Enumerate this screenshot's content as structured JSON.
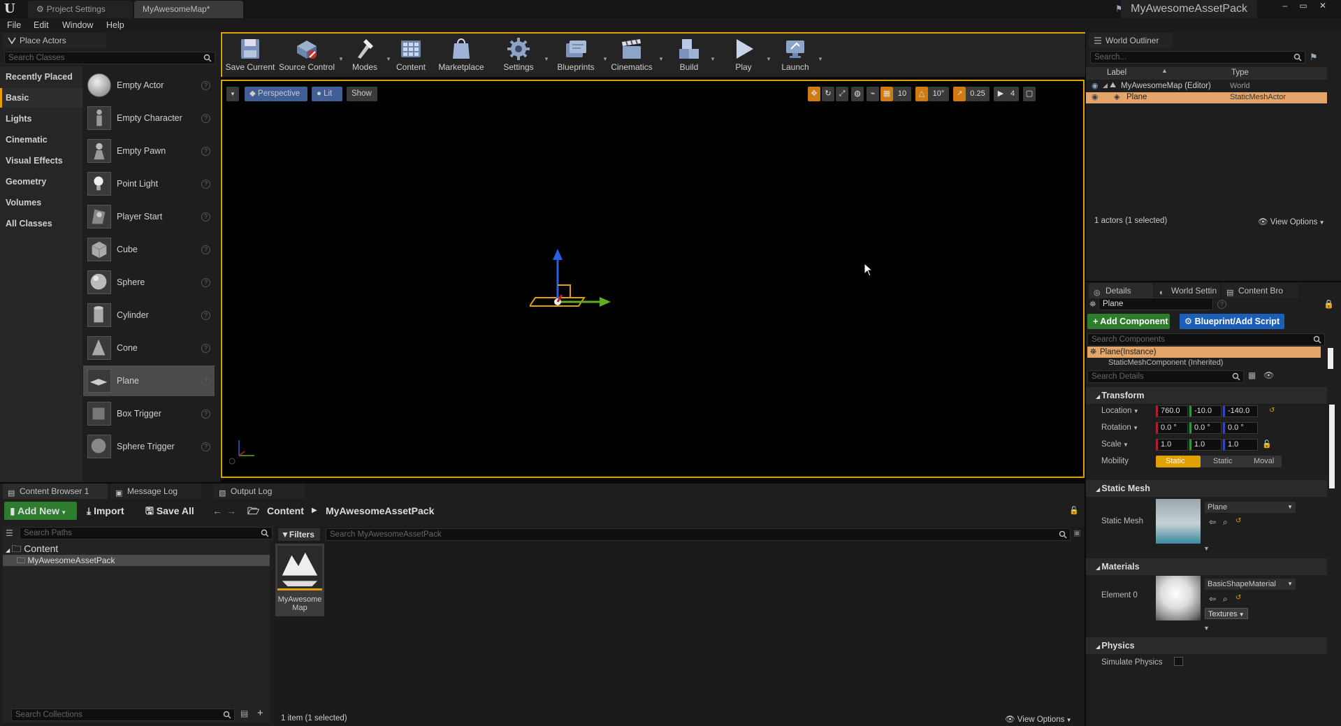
{
  "titlebar": {
    "tabs": [
      {
        "label": "Project Settings"
      },
      {
        "label": "MyAwesomeMap*"
      }
    ],
    "project_name": "MyAwesomeAssetPack",
    "controls": {
      "minimize": "–",
      "maximize": "▭",
      "close": "✕"
    }
  },
  "menu": [
    "File",
    "Edit",
    "Window",
    "Help"
  ],
  "place_actors": {
    "tab_label": "Place Actors",
    "search_placeholder": "Search Classes",
    "categories": [
      "Recently Placed",
      "Basic",
      "Lights",
      "Cinematic",
      "Visual Effects",
      "Geometry",
      "Volumes",
      "All Classes"
    ],
    "selected_category": "Basic",
    "items": [
      "Empty Actor",
      "Empty Character",
      "Empty Pawn",
      "Point Light",
      "Player Start",
      "Cube",
      "Sphere",
      "Cylinder",
      "Cone",
      "Plane",
      "Box Trigger",
      "Sphere Trigger"
    ],
    "selected_item": "Plane",
    "help_glyph": "?"
  },
  "toolbar": {
    "buttons": [
      "Save Current",
      "Source Control",
      "Modes",
      "Content",
      "Marketplace",
      "Settings",
      "Blueprints",
      "Cinematics",
      "Build",
      "Play",
      "Launch"
    ]
  },
  "viewport": {
    "perspective": "Perspective",
    "lit": "Lit",
    "show": "Show",
    "grid_snap": "10",
    "rotation_snap": "10°",
    "scale_snap": "0.25",
    "camera_speed": "4",
    "colors": {
      "border": "#e0a000",
      "gizmo_z": "#2a5de0",
      "gizmo_y": "#5fae1e",
      "gizmo_x": "#c02020"
    }
  },
  "outliner": {
    "tab_label": "World Outliner",
    "search_placeholder": "Search...",
    "col_label": "Label",
    "col_type": "Type",
    "rows": [
      {
        "label": "MyAwesomeMap (Editor)",
        "type": "World"
      },
      {
        "label": "Plane",
        "type": "StaticMeshActor"
      }
    ],
    "status": "1 actors (1 selected)",
    "view_options": "View Options"
  },
  "details": {
    "tabs": [
      "Details",
      "World Settin",
      "Content Bro"
    ],
    "actor_name": "Plane",
    "add_component": "+ Add Component",
    "blueprint_script": "Blueprint/Add Script",
    "search_components": "Search Components",
    "component_root": "Plane(Instance)",
    "component_child": "StaticMeshComponent (Inherited)",
    "search_details": "Search Details",
    "transform": {
      "header": "Transform",
      "location_label": "Location",
      "location": [
        "760.0",
        "-10.0",
        "-140.0"
      ],
      "rotation_label": "Rotation",
      "rotation": [
        "0.0 °",
        "0.0 °",
        "0.0 °"
      ],
      "scale_label": "Scale",
      "scale": [
        "1.0",
        "1.0",
        "1.0"
      ],
      "mobility_label": "Mobility",
      "mobility": [
        "Static",
        "Static",
        "Moval"
      ]
    },
    "static_mesh": {
      "header": "Static Mesh",
      "label": "Static Mesh",
      "value": "Plane"
    },
    "materials": {
      "header": "Materials",
      "element_label": "Element 0",
      "value": "BasicShapeMaterial",
      "textures": "Textures"
    },
    "physics": {
      "header": "Physics",
      "simulate_label": "Simulate Physics"
    }
  },
  "bottom": {
    "tabs": [
      "Content Browser 1",
      "Message Log",
      "Output Log"
    ],
    "add_new": "Add New",
    "import": "Import",
    "save_all": "Save All",
    "path_root": "Content",
    "path_leaf": "MyAwesomeAssetPack",
    "search_paths": "Search Paths",
    "tree_root": "Content",
    "tree_child": "MyAwesomeAssetPack",
    "filters": "Filters",
    "search_assets": "Search MyAwesomeAssetPack",
    "asset_name": "MyAwesome Map",
    "search_collections": "Search Collections",
    "status": "1 item (1 selected)",
    "view_options": "View Options"
  }
}
